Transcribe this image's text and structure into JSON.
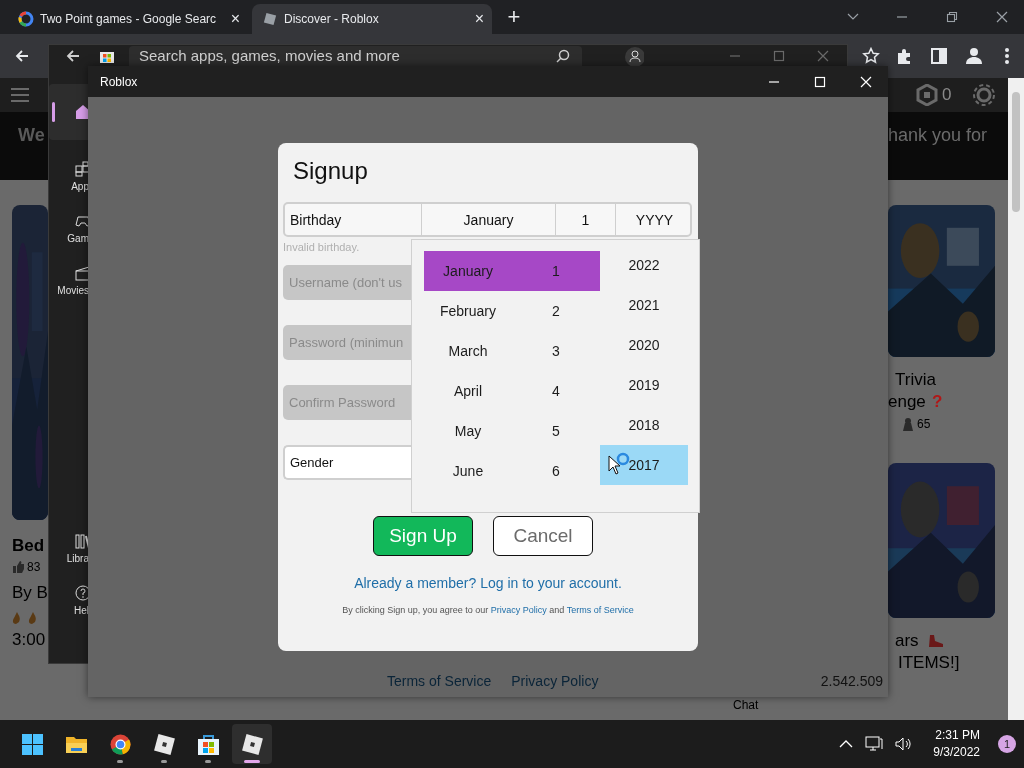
{
  "browser": {
    "tabs": [
      {
        "title": "Two Point games - Google Searc",
        "close": "×",
        "selected": false
      },
      {
        "title": "Discover - Roblox",
        "close": "×",
        "selected": true
      }
    ],
    "new_tab": "+"
  },
  "background_page": {
    "robux_count": "0",
    "banner_left": "We",
    "banner_right": "hank you for",
    "left_card": {
      "title": "Bed",
      "likes": "83",
      "creator": "By B",
      "time": "3:00"
    },
    "right_cards": [
      {
        "lines": [
          "Trivia",
          "enge"
        ],
        "mark": "?",
        "players": "65"
      },
      {
        "lines": [
          "ars",
          "ITEMS!]"
        ]
      }
    ],
    "chat": "Chat"
  },
  "store_window": {
    "search": {
      "placeholder": "Search apps, games, movies and more"
    },
    "nav": [
      {
        "kind": "home",
        "selected": true
      },
      {
        "kind": "apps",
        "label": "App",
        "selected": false
      },
      {
        "kind": "games",
        "label": "Gam",
        "selected": false
      },
      {
        "kind": "movies",
        "label": "Movies",
        "selected": false
      },
      {
        "kind": "library",
        "label": "Libra",
        "selected": false
      },
      {
        "kind": "help",
        "label": "Hel",
        "selected": false
      }
    ]
  },
  "roblox_window": {
    "title": "Roblox",
    "footer_links": [
      "Terms of Service",
      "Privacy Policy"
    ],
    "version": "2.542.509"
  },
  "signup": {
    "title": "Signup",
    "birthday": {
      "label": "Birthday",
      "month": "January",
      "day": "1",
      "year": "YYYY"
    },
    "error": "Invalid birthday.",
    "fields": [
      {
        "kind": "text",
        "placeholder": "Username (don't us"
      },
      {
        "kind": "text",
        "placeholder": "Password (minimun"
      },
      {
        "kind": "text",
        "placeholder": "Confirm Password"
      },
      {
        "kind": "select",
        "value": "Gender"
      }
    ],
    "buttons": [
      {
        "kind": "primary",
        "label": "Sign Up"
      },
      {
        "kind": "secondary",
        "label": "Cancel"
      }
    ],
    "login_link": "Already a member? Log in to your account.",
    "terms": {
      "text": "By clicking Sign up, you agree to our",
      "privacy": "Privacy Policy",
      "and": "and",
      "tos": "Terms of Service"
    }
  },
  "date_picker": {
    "rows": [
      {
        "month": "January",
        "day": "1",
        "selected": true
      },
      {
        "month": "February",
        "day": "2",
        "selected": false
      },
      {
        "month": "March",
        "day": "3",
        "selected": false
      },
      {
        "month": "April",
        "day": "4",
        "selected": false
      },
      {
        "month": "May",
        "day": "5",
        "selected": false
      },
      {
        "month": "June",
        "day": "6",
        "selected": false
      }
    ],
    "years": [
      {
        "year": "2022",
        "hovered": false
      },
      {
        "year": "2021",
        "hovered": false
      },
      {
        "year": "2020",
        "hovered": false
      },
      {
        "year": "2019",
        "hovered": false
      },
      {
        "year": "2018",
        "hovered": false
      },
      {
        "year": "2017",
        "hovered": true
      }
    ]
  },
  "taskbar": {
    "apps": [
      {
        "kind": "start",
        "running": false,
        "active": false
      },
      {
        "kind": "files",
        "running": false,
        "active": false
      },
      {
        "kind": "browser",
        "running": true,
        "active": false
      },
      {
        "kind": "roblox",
        "running": true,
        "active": false
      },
      {
        "kind": "store",
        "running": true,
        "active": false
      },
      {
        "kind": "roblox",
        "running": true,
        "active": true
      }
    ],
    "time": "2:31 PM",
    "date": "9/3/2022",
    "notifications": "1"
  }
}
